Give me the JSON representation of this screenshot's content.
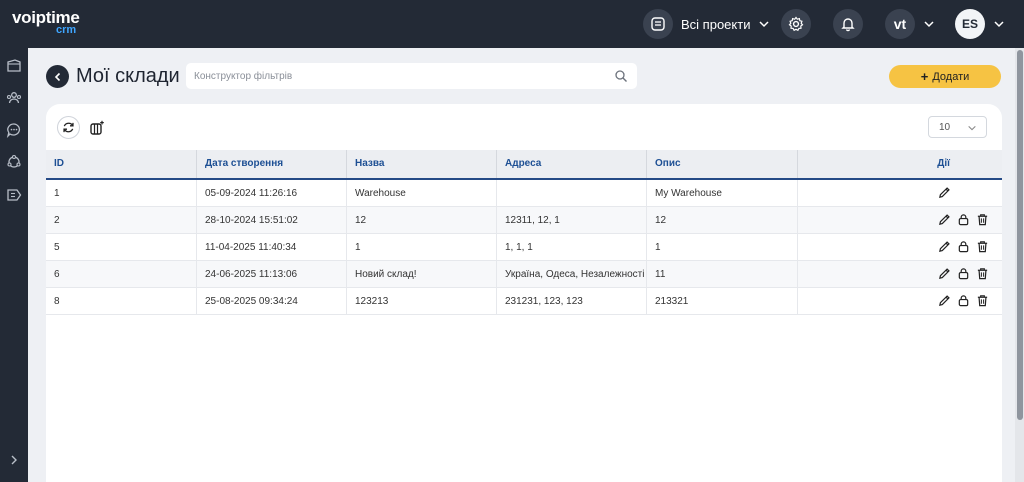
{
  "app": {
    "logo_main": "voiptime",
    "logo_sub": "crm"
  },
  "topbar": {
    "projects_label": "Всі проекти",
    "brand_badge": "vt",
    "user_initials": "ES"
  },
  "page": {
    "title": "Мої склади",
    "search_placeholder": "Конструктор фільтрів",
    "add_label": "Додати"
  },
  "table": {
    "page_size": "10",
    "columns": [
      "ID",
      "Дата створення",
      "Назва",
      "Адреса",
      "Опис",
      "Дії"
    ],
    "rows": [
      {
        "id": "1",
        "created": "05-09-2024 11:26:16",
        "name": "Warehouse",
        "address": "",
        "description": "My Warehouse",
        "actions": [
          "edit-icon"
        ]
      },
      {
        "id": "2",
        "created": "28-10-2024 15:51:02",
        "name": "12",
        "address": "12311, 12, 1",
        "description": "12",
        "actions": [
          "edit-icon",
          "lock-icon",
          "trash-icon"
        ]
      },
      {
        "id": "5",
        "created": "11-04-2025 11:40:34",
        "name": "1",
        "address": "1, 1, 1",
        "description": "1",
        "actions": [
          "edit-icon",
          "lock-icon",
          "trash-icon"
        ]
      },
      {
        "id": "6",
        "created": "24-06-2025 11:13:06",
        "name": "Новий склад!",
        "address": "Україна, Одеса, Незалежності",
        "description": "11",
        "actions": [
          "edit-icon",
          "lock-icon",
          "trash-icon"
        ]
      },
      {
        "id": "8",
        "created": "25-08-2025 09:34:24",
        "name": "123213",
        "address": "231231, 123, 123",
        "description": "213321",
        "actions": [
          "edit-icon",
          "lock-icon",
          "trash-icon"
        ]
      }
    ]
  },
  "colors": {
    "topbar": "#232a36",
    "accent_button": "#f6c343",
    "header_text": "#1d4f94"
  }
}
